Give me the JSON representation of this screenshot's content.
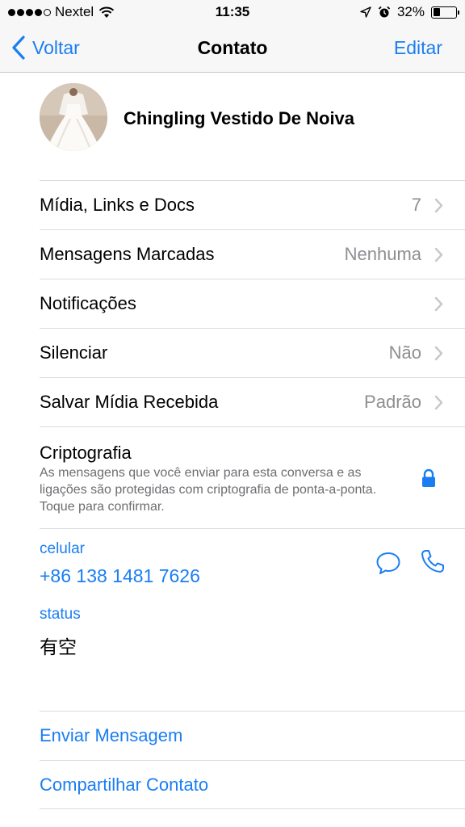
{
  "status_bar": {
    "carrier": "Nextel",
    "time": "11:35",
    "battery_percent": "32%",
    "battery_level": 0.32,
    "signal_bars_filled": 4,
    "signal_bars_total": 5
  },
  "nav": {
    "back_label": "Voltar",
    "title": "Contato",
    "edit_label": "Editar"
  },
  "profile": {
    "name": "Chingling Vestido De Noiva"
  },
  "rows": [
    {
      "label": "Mídia, Links e Docs",
      "value": "7"
    },
    {
      "label": "Mensagens Marcadas",
      "value": "Nenhuma"
    },
    {
      "label": "Notificações",
      "value": ""
    },
    {
      "label": "Silenciar",
      "value": "Não"
    },
    {
      "label": "Salvar Mídia Recebida",
      "value": "Padrão"
    }
  ],
  "crypto": {
    "title": "Criptografia",
    "description": "As mensagens que você enviar para esta conversa e as ligações são protegidas com criptografia de ponta-a-ponta. Toque para confirmar."
  },
  "phone": {
    "label": "celular",
    "number": "+86 138 1481 7626"
  },
  "status": {
    "label": "status",
    "value": "有空"
  },
  "actions": [
    {
      "label": "Enviar Mensagem"
    },
    {
      "label": "Compartilhar Contato"
    }
  ],
  "colors": {
    "accent": "#1a7ef2",
    "secondary_text": "#8e8e93",
    "separator": "#dcdcdf",
    "bar_background": "#f7f7f7"
  }
}
